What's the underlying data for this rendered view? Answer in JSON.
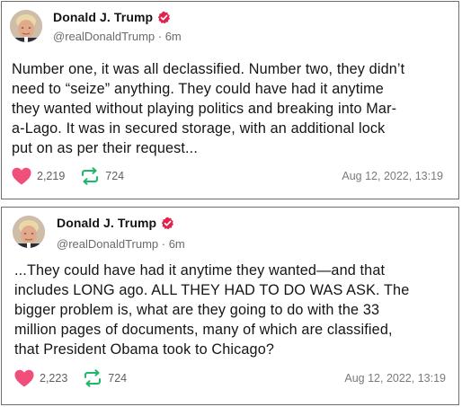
{
  "posts": [
    {
      "author": {
        "name": "Donald J. Trump",
        "handle": "@realDonaldTrump · 6m"
      },
      "text": "Number one, it was all declassified. Number two, they didn’t\nneed to “seize” anything. They could have had it anytime\nthey wanted without playing politics and breaking into Mar-\na-Lago. It was in secured storage, with an additional lock\nput on as per their request...",
      "likes": "2,219",
      "retruths": "724",
      "date": "Aug 12, 2022, 13:19"
    },
    {
      "author": {
        "name": "Donald J. Trump",
        "handle": "@realDonaldTrump · 6m"
      },
      "text": "...They could have had it anytime they wanted—and that\nincludes LONG ago. ALL THEY HAD TO DO WAS ASK. The\nbigger problem is, what are they going to do with the 33\nmillion pages of documents, many of which are classified,\nthat President Obama took to Chicago?",
      "likes": "2,223",
      "retruths": "724",
      "date": "Aug 12, 2022, 13:19"
    }
  ],
  "icons": {
    "verified": "verified-badge-icon",
    "like": "heart-icon",
    "repost": "retruth-icon"
  },
  "colors": {
    "verified_badge": "#e0234e",
    "heart": "#ef4f78",
    "retruth": "#1fb86a",
    "handle_text": "#6b6b6b",
    "border": "#6e6e6e"
  }
}
